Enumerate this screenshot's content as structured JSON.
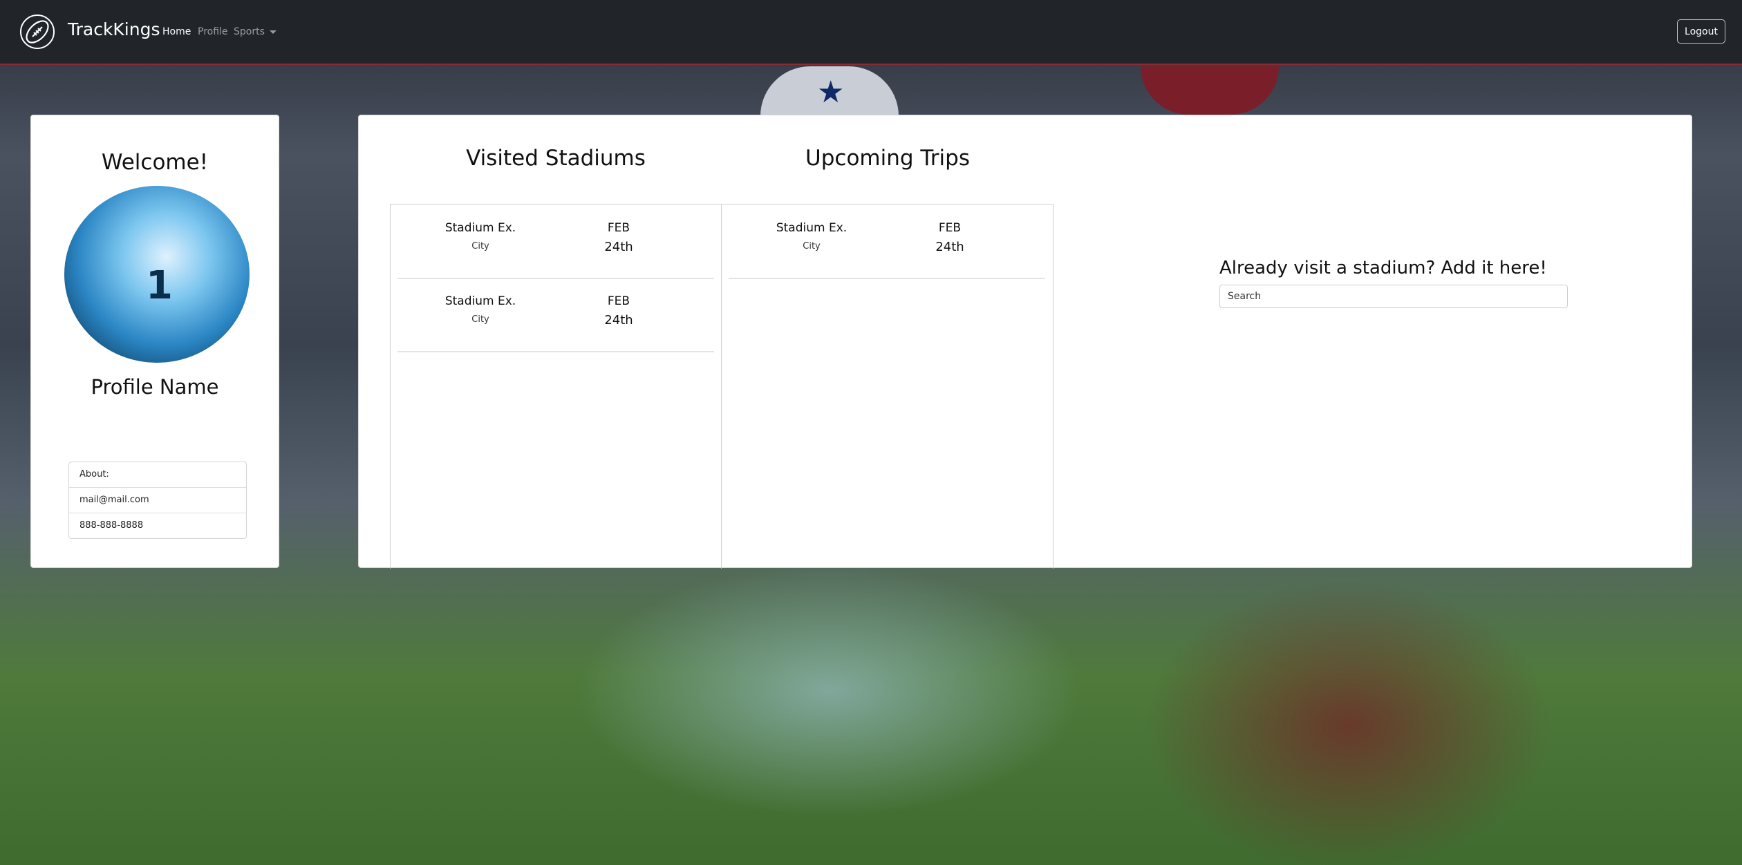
{
  "navbar": {
    "brand": "TrackKings",
    "links": [
      "Home",
      "Profile",
      "Sports"
    ],
    "logout_label": "Logout",
    "icons": {
      "logo": "football-icon",
      "dropdown": "caret-down-icon"
    }
  },
  "profile": {
    "welcome": "Welcome!",
    "name": "Profile Name",
    "about_label": "About:",
    "email": "mail@mail.com",
    "phone": "888-888-8888"
  },
  "visited": {
    "title": "Visited Stadiums",
    "items": [
      {
        "name": "Stadium Ex.",
        "city": "City",
        "month": "FEB",
        "day": "24th"
      },
      {
        "name": "Stadium Ex.",
        "city": "City",
        "month": "FEB",
        "day": "24th"
      }
    ]
  },
  "upcoming": {
    "title": "Upcoming Trips",
    "items": [
      {
        "name": "Stadium Ex.",
        "city": "City",
        "month": "FEB",
        "day": "24th"
      }
    ]
  },
  "add_stadium": {
    "heading": "Already visit a stadium? Add it here!",
    "search_placeholder": "Search"
  },
  "colors": {
    "navbar_bg": "#212529",
    "card_bg": "#ffffff"
  }
}
